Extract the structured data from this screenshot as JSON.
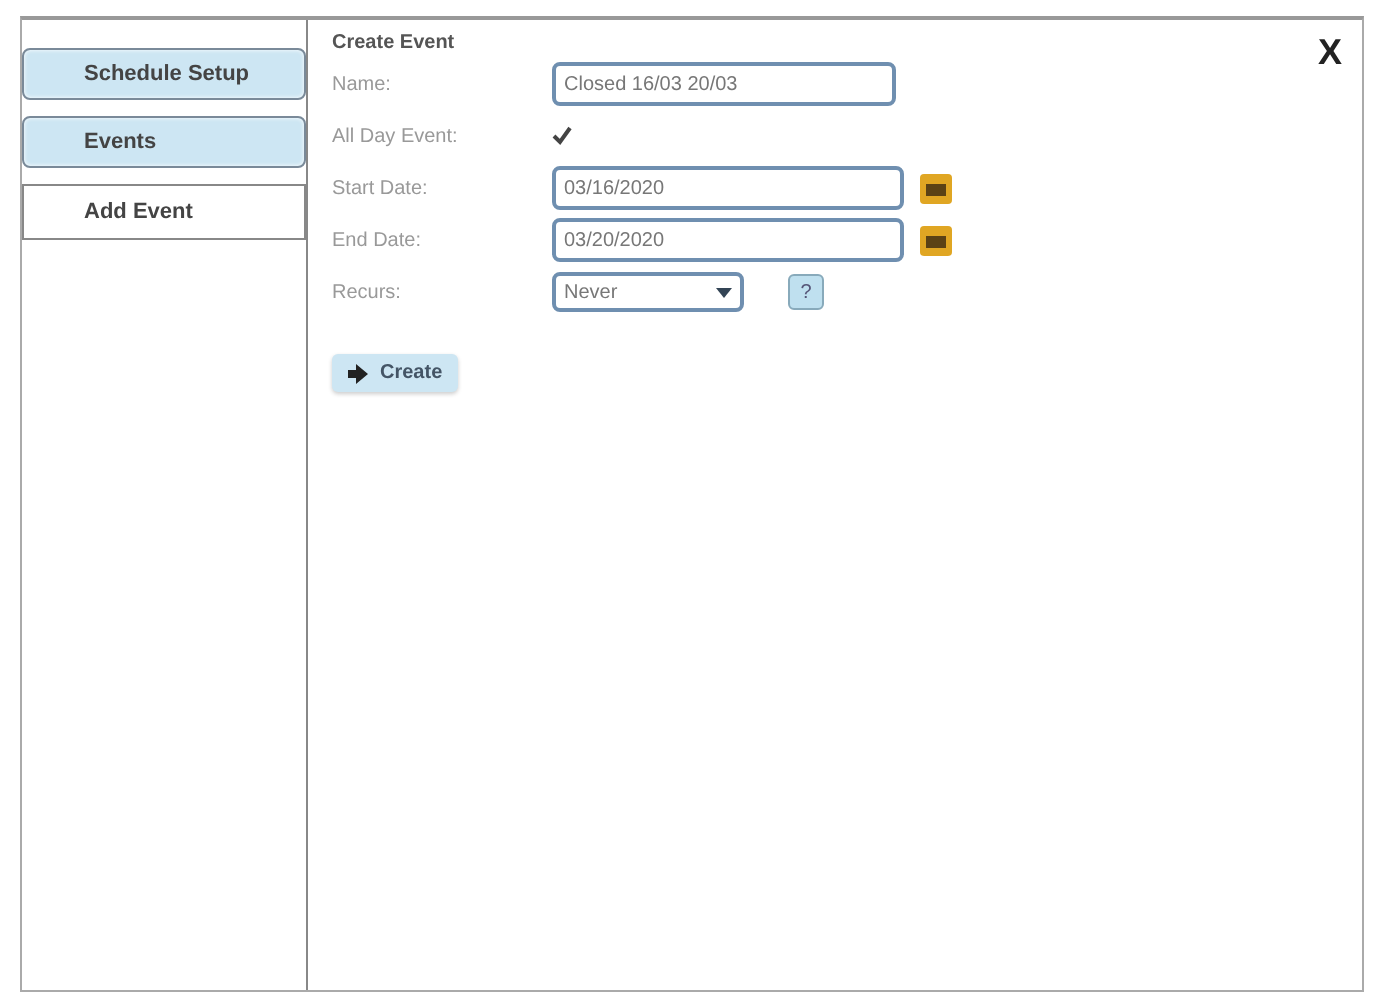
{
  "sidebar": {
    "tabs": [
      {
        "label": "Schedule Setup",
        "selected": false
      },
      {
        "label": "Events",
        "selected": false
      },
      {
        "label": "Add Event",
        "selected": true
      }
    ]
  },
  "form": {
    "title": "Create Event",
    "close": "X",
    "fields": [
      {
        "kind": "text",
        "label": "Name:",
        "value": "Closed 16/03 20/03"
      },
      {
        "kind": "checkbox",
        "label": "All Day Event:",
        "checked": true
      },
      {
        "kind": "date",
        "label": "Start Date:",
        "value": "03/16/2020"
      },
      {
        "kind": "date",
        "label": "End Date:",
        "value": "03/20/2020"
      },
      {
        "kind": "select",
        "label": "Recurs:",
        "value": "Never",
        "help": "?"
      }
    ],
    "submit": "Create"
  }
}
